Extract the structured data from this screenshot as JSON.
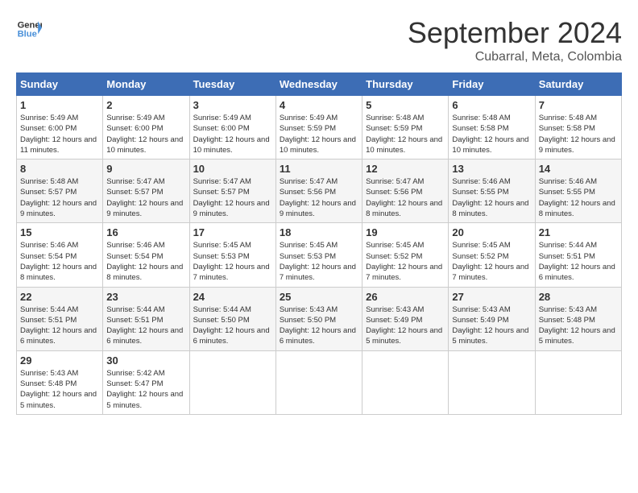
{
  "header": {
    "logo_line1": "General",
    "logo_line2": "Blue",
    "month": "September 2024",
    "location": "Cubarral, Meta, Colombia"
  },
  "days_of_week": [
    "Sunday",
    "Monday",
    "Tuesday",
    "Wednesday",
    "Thursday",
    "Friday",
    "Saturday"
  ],
  "weeks": [
    [
      {
        "day": 1,
        "sunrise": "5:49 AM",
        "sunset": "6:00 PM",
        "daylight": "12 hours and 11 minutes."
      },
      {
        "day": 2,
        "sunrise": "5:49 AM",
        "sunset": "6:00 PM",
        "daylight": "12 hours and 10 minutes."
      },
      {
        "day": 3,
        "sunrise": "5:49 AM",
        "sunset": "6:00 PM",
        "daylight": "12 hours and 10 minutes."
      },
      {
        "day": 4,
        "sunrise": "5:49 AM",
        "sunset": "5:59 PM",
        "daylight": "12 hours and 10 minutes."
      },
      {
        "day": 5,
        "sunrise": "5:48 AM",
        "sunset": "5:59 PM",
        "daylight": "12 hours and 10 minutes."
      },
      {
        "day": 6,
        "sunrise": "5:48 AM",
        "sunset": "5:58 PM",
        "daylight": "12 hours and 10 minutes."
      },
      {
        "day": 7,
        "sunrise": "5:48 AM",
        "sunset": "5:58 PM",
        "daylight": "12 hours and 9 minutes."
      }
    ],
    [
      {
        "day": 8,
        "sunrise": "5:48 AM",
        "sunset": "5:57 PM",
        "daylight": "12 hours and 9 minutes."
      },
      {
        "day": 9,
        "sunrise": "5:47 AM",
        "sunset": "5:57 PM",
        "daylight": "12 hours and 9 minutes."
      },
      {
        "day": 10,
        "sunrise": "5:47 AM",
        "sunset": "5:57 PM",
        "daylight": "12 hours and 9 minutes."
      },
      {
        "day": 11,
        "sunrise": "5:47 AM",
        "sunset": "5:56 PM",
        "daylight": "12 hours and 9 minutes."
      },
      {
        "day": 12,
        "sunrise": "5:47 AM",
        "sunset": "5:56 PM",
        "daylight": "12 hours and 8 minutes."
      },
      {
        "day": 13,
        "sunrise": "5:46 AM",
        "sunset": "5:55 PM",
        "daylight": "12 hours and 8 minutes."
      },
      {
        "day": 14,
        "sunrise": "5:46 AM",
        "sunset": "5:55 PM",
        "daylight": "12 hours and 8 minutes."
      }
    ],
    [
      {
        "day": 15,
        "sunrise": "5:46 AM",
        "sunset": "5:54 PM",
        "daylight": "12 hours and 8 minutes."
      },
      {
        "day": 16,
        "sunrise": "5:46 AM",
        "sunset": "5:54 PM",
        "daylight": "12 hours and 8 minutes."
      },
      {
        "day": 17,
        "sunrise": "5:45 AM",
        "sunset": "5:53 PM",
        "daylight": "12 hours and 7 minutes."
      },
      {
        "day": 18,
        "sunrise": "5:45 AM",
        "sunset": "5:53 PM",
        "daylight": "12 hours and 7 minutes."
      },
      {
        "day": 19,
        "sunrise": "5:45 AM",
        "sunset": "5:52 PM",
        "daylight": "12 hours and 7 minutes."
      },
      {
        "day": 20,
        "sunrise": "5:45 AM",
        "sunset": "5:52 PM",
        "daylight": "12 hours and 7 minutes."
      },
      {
        "day": 21,
        "sunrise": "5:44 AM",
        "sunset": "5:51 PM",
        "daylight": "12 hours and 6 minutes."
      }
    ],
    [
      {
        "day": 22,
        "sunrise": "5:44 AM",
        "sunset": "5:51 PM",
        "daylight": "12 hours and 6 minutes."
      },
      {
        "day": 23,
        "sunrise": "5:44 AM",
        "sunset": "5:51 PM",
        "daylight": "12 hours and 6 minutes."
      },
      {
        "day": 24,
        "sunrise": "5:44 AM",
        "sunset": "5:50 PM",
        "daylight": "12 hours and 6 minutes."
      },
      {
        "day": 25,
        "sunrise": "5:43 AM",
        "sunset": "5:50 PM",
        "daylight": "12 hours and 6 minutes."
      },
      {
        "day": 26,
        "sunrise": "5:43 AM",
        "sunset": "5:49 PM",
        "daylight": "12 hours and 5 minutes."
      },
      {
        "day": 27,
        "sunrise": "5:43 AM",
        "sunset": "5:49 PM",
        "daylight": "12 hours and 5 minutes."
      },
      {
        "day": 28,
        "sunrise": "5:43 AM",
        "sunset": "5:48 PM",
        "daylight": "12 hours and 5 minutes."
      }
    ],
    [
      {
        "day": 29,
        "sunrise": "5:43 AM",
        "sunset": "5:48 PM",
        "daylight": "12 hours and 5 minutes."
      },
      {
        "day": 30,
        "sunrise": "5:42 AM",
        "sunset": "5:47 PM",
        "daylight": "12 hours and 5 minutes."
      },
      null,
      null,
      null,
      null,
      null
    ]
  ]
}
